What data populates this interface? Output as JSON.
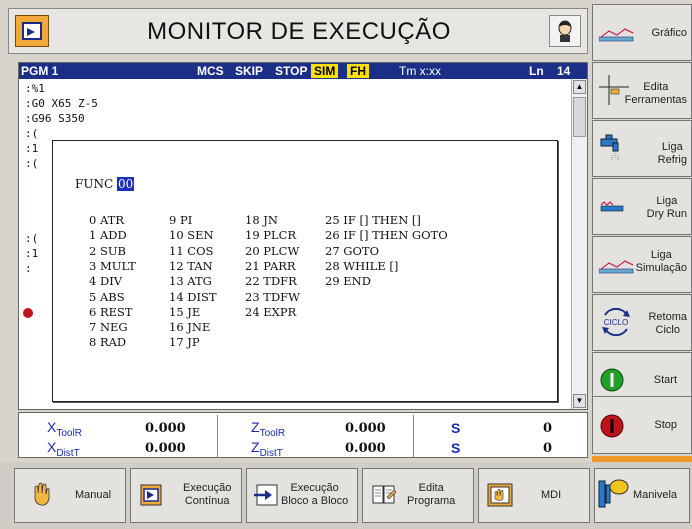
{
  "window": {
    "title": "MONITOR DE EXECUÇÃO"
  },
  "pgm": {
    "name": "PGM 1",
    "flags": {
      "mcs": "MCS",
      "skip": "SKIP",
      "stop": "STOP",
      "sim": "SIM",
      "fh": "FH"
    },
    "tm": "Tm x:xx",
    "ln_label": "Ln",
    "ln_value": "14",
    "lines": [
      ":%1",
      ":G0 X65 Z-5",
      ":G96 S350",
      ":(",
      ":1",
      ":(",
      ":(",
      ":1",
      ":"
    ]
  },
  "func_dialog": {
    "label": "FUNC",
    "code": "00",
    "columns": [
      [
        "0 ATR",
        "1 ADD",
        "2 SUB",
        "3 MULT",
        "4 DIV",
        "5 ABS",
        "6 REST",
        "7 NEG",
        "8 RAD"
      ],
      [
        "9 PI",
        "10 SEN",
        "11 COS",
        "12 TAN",
        "13 ATG",
        "14 DIST",
        "15 JE",
        "16 JNE",
        "17 JP"
      ],
      [
        "18 JN",
        "19 PLCR",
        "20 PLCW",
        "21 PARR",
        "22 TDFR",
        "23 TDFW",
        "24 EXPR"
      ],
      [
        "25 IF [] THEN []",
        "26 IF [] THEN GOTO",
        "27 GOTO",
        "28 WHILE []",
        "29 END"
      ]
    ]
  },
  "status": {
    "x_tool_label": "X",
    "x_tool_sub": "ToolR",
    "x_tool_val": "0.000",
    "x_dist_label": "X",
    "x_dist_sub": "DistT",
    "x_dist_val": "0.000",
    "z_tool_label": "Z",
    "z_tool_sub": "ToolR",
    "z_tool_val": "0.000",
    "z_dist_label": "Z",
    "z_dist_sub": "DistT",
    "z_dist_val": "0.000",
    "s1_label": "S",
    "s1_val": "0",
    "s2_label": "S",
    "s2_val": "0"
  },
  "right_keys": {
    "grafico": "Gráfico",
    "edita_ferr_1": "Edita",
    "edita_ferr_2": "Ferramentas",
    "liga_refrig_1": "Liga",
    "liga_refrig_2": "Refrig",
    "liga_dry_1": "Liga",
    "liga_dry_2": "Dry Run",
    "liga_sim_1": "Liga",
    "liga_sim_2": "Simulação",
    "retoma_1": "Retoma",
    "retoma_2": "Ciclo",
    "retoma_icon_text": "CICLO",
    "start": "Start",
    "stop": "Stop"
  },
  "bottom_keys": {
    "manual": "Manual",
    "exec_cont_1": "Execução",
    "exec_cont_2": "Contínua",
    "exec_bloco_1": "Execução",
    "exec_bloco_2": "Bloco a Bloco",
    "edita_prog_1": "Edita",
    "edita_prog_2": "Programa",
    "mdi": "MDI",
    "manivela": "Manivela"
  },
  "colors": {
    "accent_orange": "#f2a93b",
    "header_blue": "#1b2f86",
    "flag_yellow": "#ffe000",
    "stop_red": "#c0121b",
    "start_green": "#1fa12a"
  }
}
